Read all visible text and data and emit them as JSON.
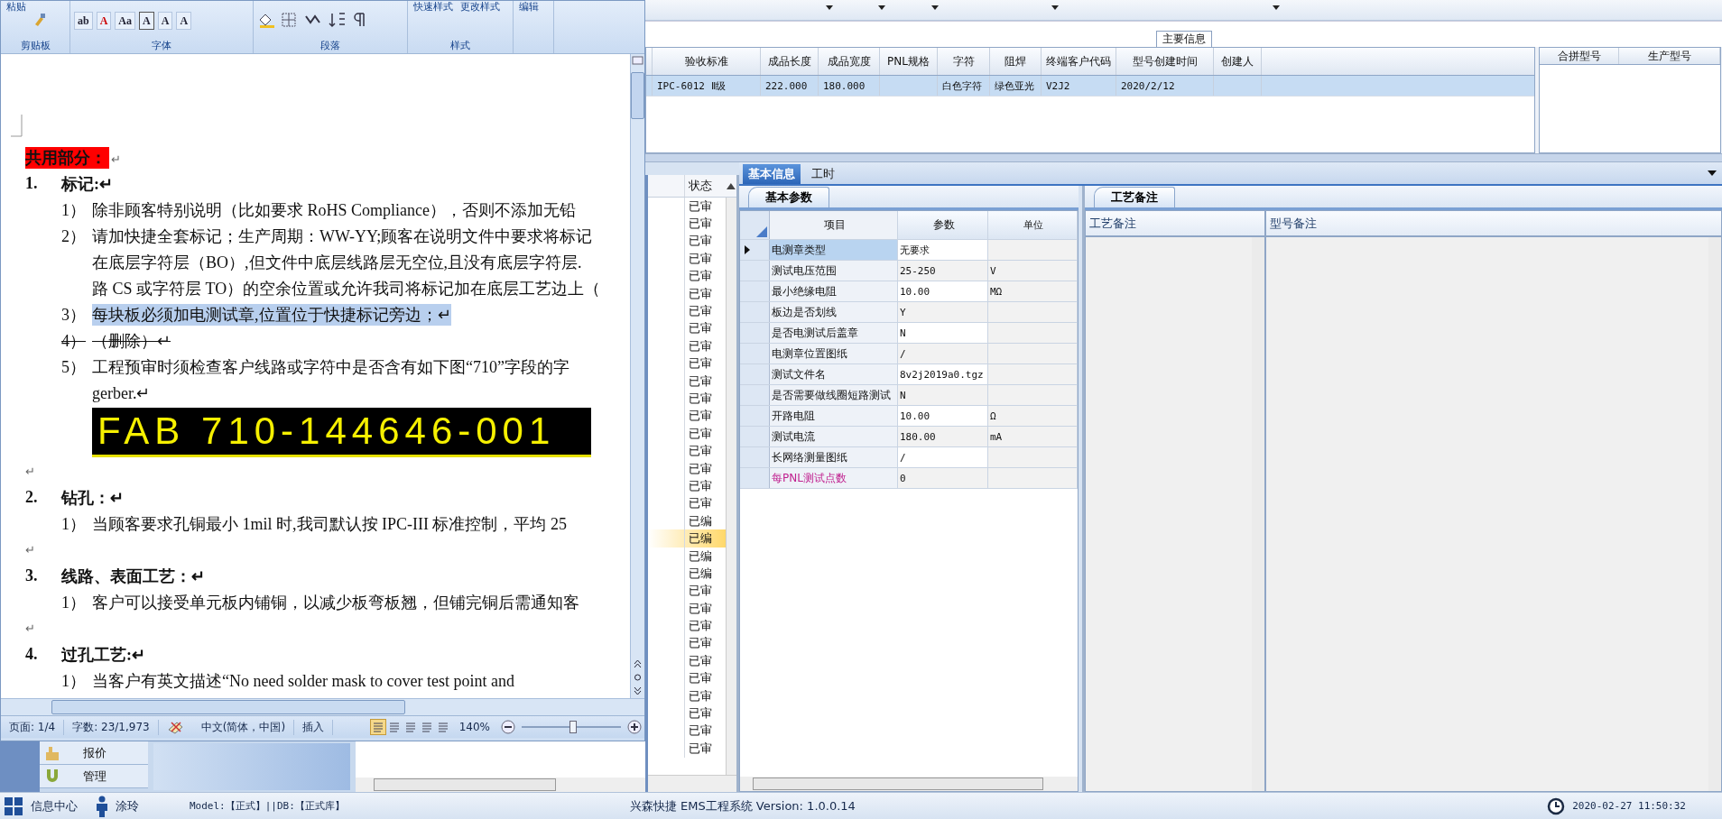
{
  "word": {
    "ribbon_groups": [
      {
        "kind": "clipboard",
        "label": "剪贴板",
        "buttons": [
          "粘贴"
        ]
      },
      {
        "kind": "font",
        "label": "字体",
        "tools": [
          "ab",
          "A",
          "Aa",
          "A",
          "A",
          "A"
        ]
      },
      {
        "kind": "paragraph",
        "label": "段落"
      },
      {
        "kind": "styles",
        "label": "样式",
        "buttons": [
          "快速样式",
          "更改样式"
        ]
      },
      {
        "kind": "editing",
        "buttons": [
          "编辑"
        ]
      }
    ],
    "lines": [
      {
        "kind": "red-heading",
        "text": "共用部分：",
        "mark": "↵"
      },
      {
        "kind": "heading",
        "num": "1.",
        "text": "标记:↵"
      },
      {
        "kind": "item",
        "num": "1）",
        "text": "除非顾客特别说明（比如要求 RoHS Compliance），否则不添加无铅"
      },
      {
        "kind": "item",
        "num": "2）",
        "text": "请加快捷全套标记；生产周期：WW-YY;顾客在说明文件中要求将标记"
      },
      {
        "kind": "cont",
        "text": "在底层字符层（BO）,但文件中底层线路层无空位,且没有底层字符层."
      },
      {
        "kind": "cont",
        "text": "路 CS 或字符层 TO）的空余位置或允许我司将标记加在底层工艺边上（"
      },
      {
        "kind": "item-highlighted",
        "num": "3）",
        "text": "每块板必须加电测试章,位置位于快捷标记旁边；↵"
      },
      {
        "kind": "item-deleted",
        "num": "4）",
        "text": "（删除）↵"
      },
      {
        "kind": "item",
        "num": "5）",
        "text": "工程预审时须检查客户线路或字符中是否含有如下图“710”字段的字"
      },
      {
        "kind": "cont",
        "text": "gerber.↵"
      },
      {
        "kind": "image",
        "text": "FAB 710-144646-001"
      },
      {
        "kind": "blank",
        "text": "↵"
      },
      {
        "kind": "heading",
        "num": "2.",
        "text": "钻孔：↵"
      },
      {
        "kind": "item",
        "num": "1）",
        "text": "当顾客要求孔铜最小 1mil 时,我司默认按 IPC-III 标准控制，平均 25"
      },
      {
        "kind": "blank",
        "text": "↵"
      },
      {
        "kind": "heading",
        "num": "3.",
        "text": "线路、表面工艺：↵"
      },
      {
        "kind": "item",
        "num": "1）",
        "text": "客户可以接受单元板内铺铜，以减少板弯板翘，但铺完铜后需通知客"
      },
      {
        "kind": "blank",
        "text": "↵"
      },
      {
        "kind": "heading",
        "num": "4.",
        "text": "过孔工艺:↵"
      },
      {
        "kind": "item",
        "num": "1）",
        "text": "当客户有英文描述“No need solder mask to cover test point and"
      }
    ],
    "status": {
      "page": "页面: 1/4",
      "words": "字数: 23/1,973",
      "language": "中文(简体，中国)",
      "mode": "插入",
      "zoom": "140%",
      "zoom_slider": {
        "level": 0.52
      },
      "views": [
        {
          "selected": true
        },
        {
          "selected": false
        },
        {
          "selected": false
        },
        {
          "selected": false
        },
        {
          "selected": false
        }
      ]
    }
  },
  "app": {
    "main_info": {
      "title": "主要信息",
      "columns": [
        "验收标准",
        "成品长度",
        "成品宽度",
        "PNL规格",
        "字符",
        "阻焊",
        "终端客户代码",
        "型号创建时间",
        "创建人"
      ],
      "rows": [
        {
          "selected": true,
          "cells": [
            "IPC-6012 Ⅱ级",
            "222.000",
            "180.000",
            "",
            "白色字符",
            "绿色亚光",
            "V2J2",
            "2020/2/12",
            ""
          ]
        }
      ]
    },
    "side_grid": {
      "columns": [
        "合拼型号",
        "生产型号"
      ]
    },
    "status_list": {
      "header": "状态",
      "rows": [
        {
          "text": "已审",
          "selected": false
        },
        {
          "text": "已审",
          "selected": false
        },
        {
          "text": "已审",
          "selected": false
        },
        {
          "text": "已审",
          "selected": false
        },
        {
          "text": "已审",
          "selected": false
        },
        {
          "text": "已审",
          "selected": false
        },
        {
          "text": "已审",
          "selected": false
        },
        {
          "text": "已审",
          "selected": false
        },
        {
          "text": "已审",
          "selected": false
        },
        {
          "text": "已审",
          "selected": false
        },
        {
          "text": "已审",
          "selected": false
        },
        {
          "text": "已审",
          "selected": false
        },
        {
          "text": "已审",
          "selected": false
        },
        {
          "text": "已审",
          "selected": false
        },
        {
          "text": "已审",
          "selected": false
        },
        {
          "text": "已审",
          "selected": false
        },
        {
          "text": "已审",
          "selected": false
        },
        {
          "text": "已审",
          "selected": false
        },
        {
          "text": "已编",
          "selected": false
        },
        {
          "text": "已编",
          "selected": true
        },
        {
          "text": "已编",
          "selected": false
        },
        {
          "text": "已编",
          "selected": false
        },
        {
          "text": "已审",
          "selected": false
        },
        {
          "text": "已审",
          "selected": false
        },
        {
          "text": "已审",
          "selected": false
        },
        {
          "text": "已审",
          "selected": false
        },
        {
          "text": "已审",
          "selected": false
        },
        {
          "text": "已审",
          "selected": false
        },
        {
          "text": "已审",
          "selected": false
        },
        {
          "text": "已审",
          "selected": false
        },
        {
          "text": "已审",
          "selected": false
        },
        {
          "text": "已审",
          "selected": false
        }
      ]
    },
    "detail_tabs": [
      {
        "label": "基本信息",
        "selected": true
      },
      {
        "label": "工时",
        "selected": false
      }
    ],
    "params": {
      "tab": "基本参数",
      "columns": [
        "项目",
        "参数",
        "单位"
      ],
      "rows": [
        {
          "item": "电测章类型",
          "value": "无要求",
          "unit": "",
          "selected": true,
          "highlight": false
        },
        {
          "item": "测试电压范围",
          "value": "25-250",
          "unit": "V",
          "selected": false,
          "highlight": false
        },
        {
          "item": "最小绝缘电阻",
          "value": "10.00",
          "unit": "MΩ",
          "selected": false,
          "highlight": false
        },
        {
          "item": "板边是否划线",
          "value": "Y",
          "unit": "",
          "selected": false,
          "highlight": false
        },
        {
          "item": "是否电测试后盖章",
          "value": "N",
          "unit": "",
          "selected": false,
          "highlight": false
        },
        {
          "item": "电测章位置图纸",
          "value": "/",
          "unit": "",
          "selected": false,
          "highlight": false
        },
        {
          "item": "测试文件名",
          "value": "8v2j2019a0.tgz",
          "unit": "",
          "selected": false,
          "highlight": false
        },
        {
          "item": "是否需要做线圈短路测试",
          "value": "N",
          "unit": "",
          "selected": false,
          "highlight": false
        },
        {
          "item": "开路电阻",
          "value": "10.00",
          "unit": "Ω",
          "selected": false,
          "highlight": false
        },
        {
          "item": "测试电流",
          "value": "180.00",
          "unit": "mA",
          "selected": false,
          "highlight": false
        },
        {
          "item": "长网络测量图纸",
          "value": "/",
          "unit": "",
          "selected": false,
          "highlight": false
        },
        {
          "item": "每PNL测试点数",
          "value": "0",
          "unit": "",
          "selected": false,
          "highlight": true
        }
      ]
    },
    "notes": {
      "tab": "工艺备注",
      "columns": [
        "工艺备注",
        "型号备注"
      ]
    },
    "nav": [
      {
        "kind": "quote",
        "label": "报价"
      },
      {
        "kind": "manage",
        "label": "管理"
      }
    ],
    "status_bar": {
      "info": "信息中心",
      "user": "涂玲",
      "model": "Model:【正式】||DB:【正式库】",
      "app": "兴森快捷 EMS工程系统 Version: 1.0.0.14",
      "time": "2020-02-27 11:50:32"
    }
  }
}
